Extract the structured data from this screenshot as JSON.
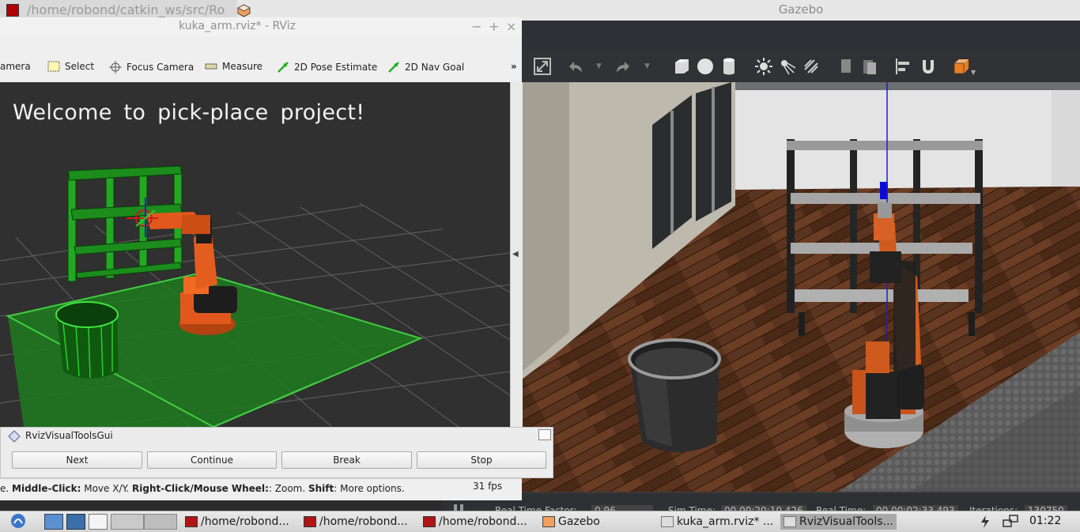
{
  "terminal": {
    "title": "/home/robond/catkin_ws/src/Ro"
  },
  "gazebo": {
    "title": "Gazebo",
    "status": {
      "real_time_factor_label": "Real Time Factor:",
      "real_time_factor": "0.96",
      "sim_time_label": "Sim Time:",
      "sim_time": "00 00:20:10.426",
      "real_time_label": "Real Time:",
      "real_time": "00 00:02:33.493",
      "iterations_label": "Iterations:",
      "iterations": "130750"
    }
  },
  "rviz": {
    "title": "kuka_arm.rviz* - RViz",
    "toolbar": {
      "camera": "amera",
      "select": "Select",
      "focus_camera": "Focus Camera",
      "measure": "Measure",
      "pose_estimate": "2D Pose Estimate",
      "nav_goal": "2D Nav Goal",
      "more": "»"
    },
    "viewport": {
      "welcome_text": "Welcome to pick-place project!"
    },
    "status": {
      "prefix": "e. ",
      "middle_click": "Middle-Click:",
      "middle_click_desc": " Move X/Y. ",
      "right_click": "Right-Click/Mouse Wheel:",
      "right_click_desc": ": Zoom. ",
      "shift": "Shift",
      "shift_desc": ": More options.",
      "fps": "31 fps"
    }
  },
  "visual_tools_gui": {
    "title": "RvizVisualToolsGui",
    "buttons": [
      "Next",
      "Continue",
      "Break",
      "Stop"
    ]
  },
  "taskbar": {
    "items": [
      "/home/robond...",
      "/home/robond...",
      "/home/robond...",
      "Gazebo",
      "kuka_arm.rviz* ...",
      "RvizVisualTools..."
    ],
    "clock": "01:22"
  },
  "colors": {
    "rviz_green": "#1fa31f",
    "kuka_orange": "#e2581c",
    "gazebo_dark": "#2e3236"
  }
}
